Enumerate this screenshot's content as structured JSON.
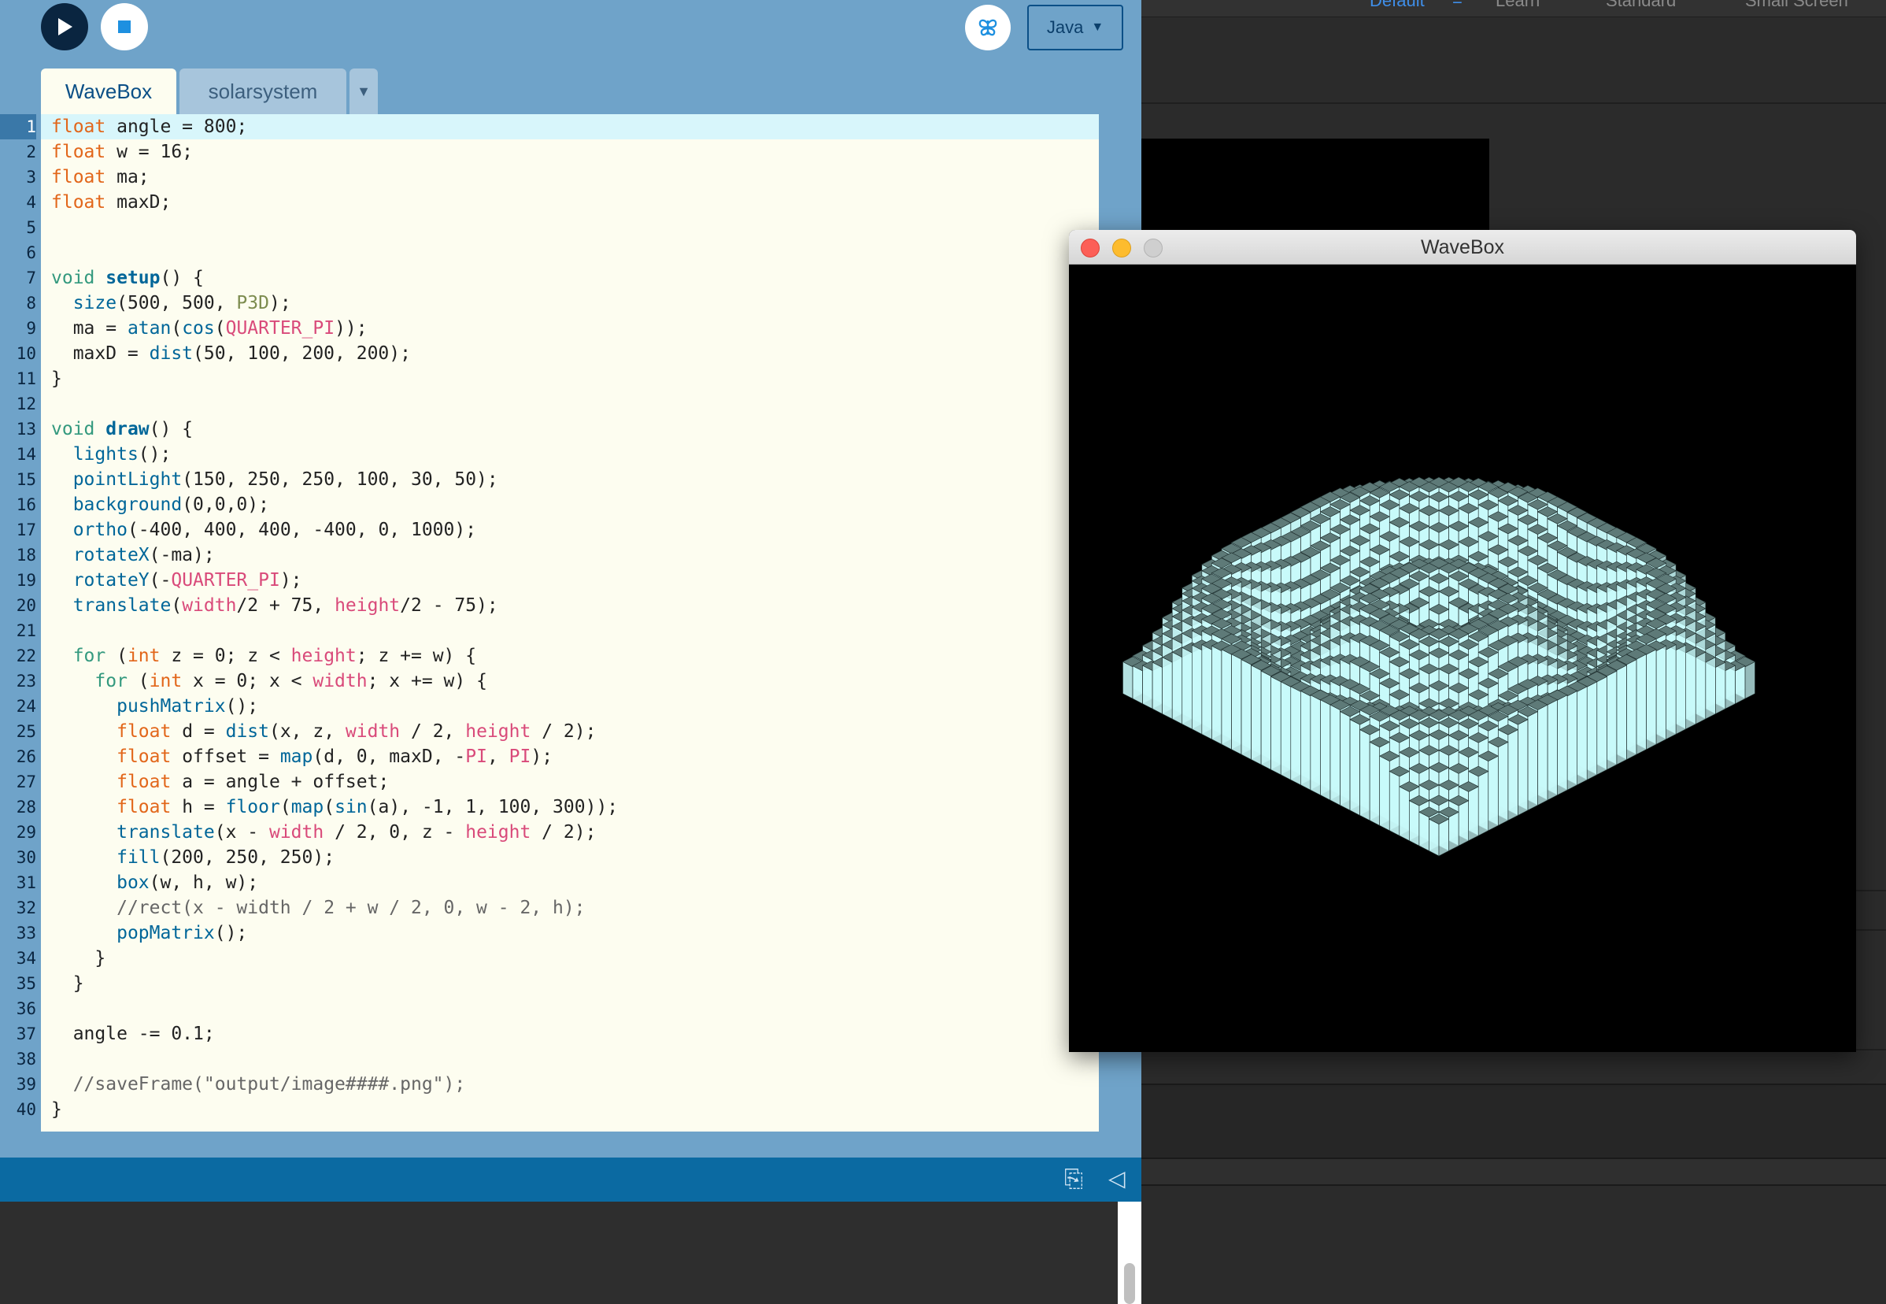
{
  "background_app": {
    "workspace_tabs": [
      "Default",
      "Learn",
      "Standard",
      "Small Screen"
    ],
    "active_workspace": "Default"
  },
  "ide": {
    "toolbar": {
      "run_icon": "play-icon",
      "stop_icon": "stop-icon",
      "debug_icon": "butterfly-icon",
      "mode_label": "Java",
      "mode_arrow": "▼"
    },
    "tabs": [
      {
        "label": "WaveBox",
        "active": true
      },
      {
        "label": "solarsystem",
        "active": false
      }
    ],
    "tab_menu_arrow": "▼",
    "current_line": 1,
    "code_lines": [
      "float angle = 800;",
      "float w = 16;",
      "float ma;",
      "float maxD;",
      "",
      "",
      "void setup() {",
      "  size(500, 500, P3D);",
      "  ma = atan(cos(QUARTER_PI));",
      "  maxD = dist(50, 100, 200, 200);",
      "}",
      "",
      "void draw() {",
      "  lights();",
      "  pointLight(150, 250, 250, 100, 30, 50);",
      "  background(0,0,0);",
      "  ortho(-400, 400, 400, -400, 0, 1000);",
      "  rotateX(-ma);",
      "  rotateY(-QUARTER_PI);",
      "  translate(width/2 + 75, height/2 - 75);",
      "",
      "  for (int z = 0; z < height; z += w) {",
      "    for (int x = 0; x < width; x += w) {",
      "      pushMatrix();",
      "      float d = dist(x, z, width / 2, height / 2);",
      "      float offset = map(d, 0, maxD, -PI, PI);",
      "      float a = angle + offset;",
      "      float h = floor(map(sin(a), -1, 1, 100, 300));",
      "      translate(x - width / 2, 0, z - height / 2);",
      "      fill(200, 250, 250);",
      "      box(w, h, w);",
      "      //rect(x - width / 2 + w / 2, 0, w - 2, h);",
      "      popMatrix();",
      "    }",
      "  }",
      "",
      "  angle -= 0.1;",
      "",
      "  //saveFrame(\"output/image####.png\");",
      "}"
    ],
    "status_icons": [
      "copy-icon",
      "collapse-icon"
    ],
    "status_glyphs": [
      "⎘",
      "◁"
    ]
  },
  "sketch_window": {
    "title": "WaveBox",
    "colors": {
      "box_fill": "#c8fafa",
      "box_shade": "#5e7a78",
      "background": "#000000"
    }
  }
}
